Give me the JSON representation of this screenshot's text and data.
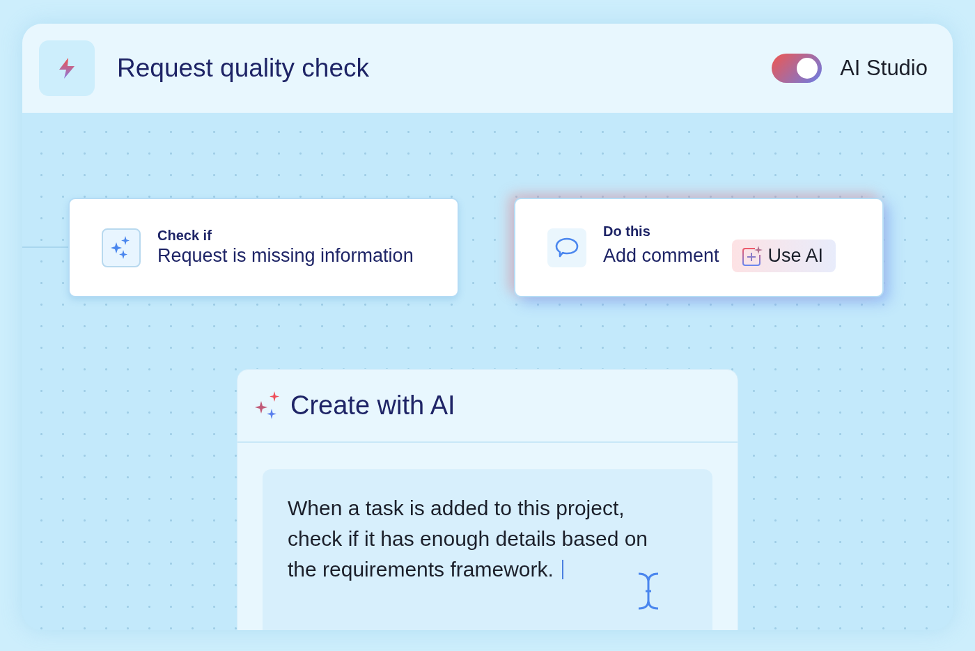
{
  "header": {
    "title": "Request quality check",
    "toggle": {
      "on": true,
      "label": "AI Studio"
    }
  },
  "nodes": [
    {
      "kind": "condition",
      "label": "Check if",
      "title": "Request is missing information"
    },
    {
      "kind": "action",
      "label": "Do this",
      "title": "Add comment",
      "button": "Use AI"
    }
  ],
  "create_panel": {
    "title": "Create with AI",
    "prompt": "When a task is added to this project, check if it has enough details based on the requirements framework."
  }
}
